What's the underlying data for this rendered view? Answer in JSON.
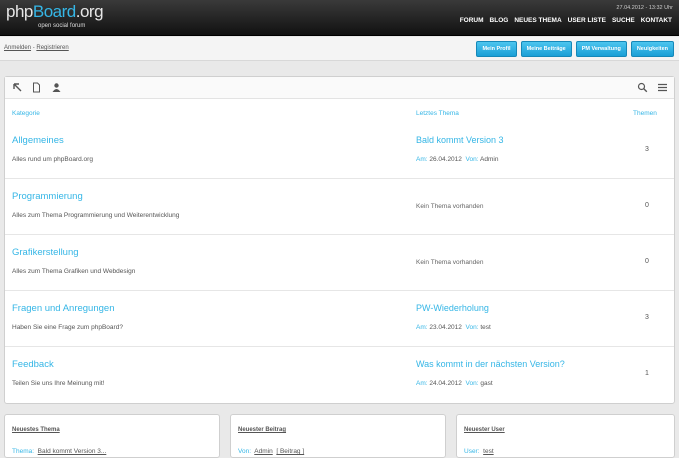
{
  "header": {
    "logo": {
      "part1": "php",
      "part2": "Board",
      "part3": ".org"
    },
    "tagline": "open social forum",
    "datetime": "27.04.2012 - 13:32 Uhr",
    "nav": [
      "FORUM",
      "BLOG",
      "NEUES THEMA",
      "USER LISTE",
      "SUCHE",
      "KONTAKT"
    ]
  },
  "breadcrumb": {
    "login": "Anmelden",
    "sep": " - ",
    "register": "Registrieren"
  },
  "user_buttons": [
    "Mein Profil",
    "Meine Beiträge",
    "PM Verwaltung",
    "Neuigkeiten"
  ],
  "table": {
    "headers": {
      "category": "Kategorie",
      "latest": "Letztes Thema",
      "topics": "Themen"
    },
    "rows": [
      {
        "title": "Allgemeines",
        "desc": "Alles rund um phpBoard.org",
        "latest": "Bald kommt Version 3",
        "am_label": "Am:",
        "am": "26.04.2012",
        "von_label": "Von:",
        "von": "Admin",
        "count": "3"
      },
      {
        "title": "Programmierung",
        "desc": "Alles zum Thema Programmierung und Weiterentwicklung",
        "none": "Kein Thema vorhanden",
        "count": "0"
      },
      {
        "title": "Grafikerstellung",
        "desc": "Alles zum Thema Grafiken und Webdesign",
        "none": "Kein Thema vorhanden",
        "count": "0"
      },
      {
        "title": "Fragen und Anregungen",
        "desc": "Haben Sie eine Frage zum phpBoard?",
        "latest": "PW-Wiederholung",
        "am_label": "Am:",
        "am": "23.04.2012",
        "von_label": "Von:",
        "von": "test",
        "count": "3"
      },
      {
        "title": "Feedback",
        "desc": "Teilen Sie uns Ihre Meinung mit!",
        "latest": "Was kommt in der nächsten Version?",
        "am_label": "Am:",
        "am": "24.04.2012",
        "von_label": "Von:",
        "von": "gast",
        "count": "1"
      }
    ]
  },
  "boxes": [
    {
      "title": "Neuestes Thema",
      "label": "Thema:",
      "value": "Bald kommt Version 3..."
    },
    {
      "title": "Neuester Beitrag",
      "label": "Von:",
      "value": "Admin",
      "extra": "[ Beitrag ]"
    },
    {
      "title": "Neuester User",
      "label": "User:",
      "value": "test"
    }
  ]
}
